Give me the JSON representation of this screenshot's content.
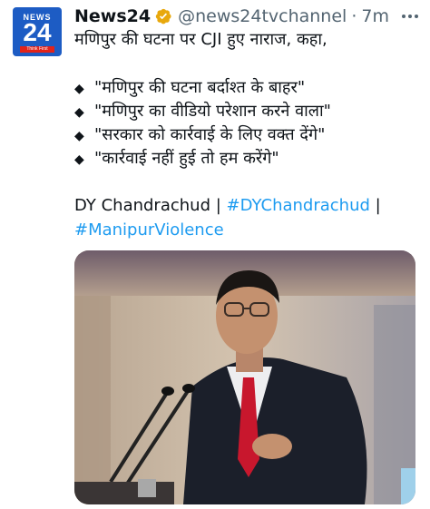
{
  "tweet": {
    "author": {
      "name": "News24",
      "handle": "@news24tvchannel",
      "timestamp": "7m",
      "separator": "·",
      "avatar": {
        "top_text": "NEWS",
        "number": "24",
        "tagline": "Think First"
      }
    },
    "lines": [
      "मणिपुर की घटना पर CJI हुए नाराज, कहा,"
    ],
    "bullet_symbol": "◆",
    "bullets": [
      "\"मणिपुर की घटना बर्दाश्त के बाहर\"",
      "\"मणिपुर का वीडियो परेशान करने वाला\"",
      "\"सरकार को कार्रवाई के लिए वक्त देंगे\"",
      "\"कार्रवाई नहीं हुई तो हम करेंगे\""
    ],
    "tags_line1": {
      "plain": "DY Chandrachud",
      "sep1": " | ",
      "hashtag1": "#DYChandrachud",
      "sep2": " |"
    },
    "tags_line2": {
      "hashtag2": "#ManipurViolence"
    }
  },
  "colors": {
    "text": "#0f1419",
    "muted": "#536471",
    "link": "#1d9bf0",
    "verified_badge": "#e8a80c",
    "avatar_bg": "#1d5cc4",
    "avatar_tag": "#e2231a"
  },
  "icons": {
    "verified": "gold-verified-badge-icon",
    "more": "more-options-icon"
  }
}
